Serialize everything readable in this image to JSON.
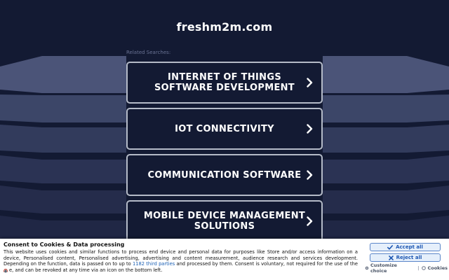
{
  "site": {
    "title": "freshm2m.com"
  },
  "related": {
    "label": "Related Searches:"
  },
  "links": [
    {
      "text": "INTERNET OF THINGS SOFTWARE DEVELOPMENT"
    },
    {
      "text": "IOT CONNECTIVITY"
    },
    {
      "text": "COMMUNICATION SOFTWARE"
    },
    {
      "text": "MOBILE DEVICE MANAGEMENT SOLUTIONS"
    }
  ],
  "consent": {
    "title": "Consent to Cookies & Data processing",
    "body_before": "This website uses cookies and similar functions to process end device and personal data for purposes like Store and/or access information on a device, Personalised content, Personalised advertising, advertising and content measurement, audience research and services development. Depending on the function, data is passed on to up to ",
    "partners_link": "1182 third parties",
    "body_after": " and processed by them. Consent is voluntary, not required for the use of the site, and can be revoked at any time via an icon on the bottom left.",
    "accept_label": "Accept all",
    "reject_label": "Reject all",
    "customize_label": "Customize choice",
    "cookies_label": "Cookies"
  },
  "colors": {
    "background": "#131a33",
    "card_border": "#b5bbc8",
    "accent_blue": "#1f58b3"
  },
  "icons": {
    "chevron": "chevron-right-icon",
    "accept": "check-icon",
    "reject": "x-icon",
    "customize": "gear-icon",
    "cookies": "cookie-icon",
    "privacy": "fingerprint-icon"
  }
}
